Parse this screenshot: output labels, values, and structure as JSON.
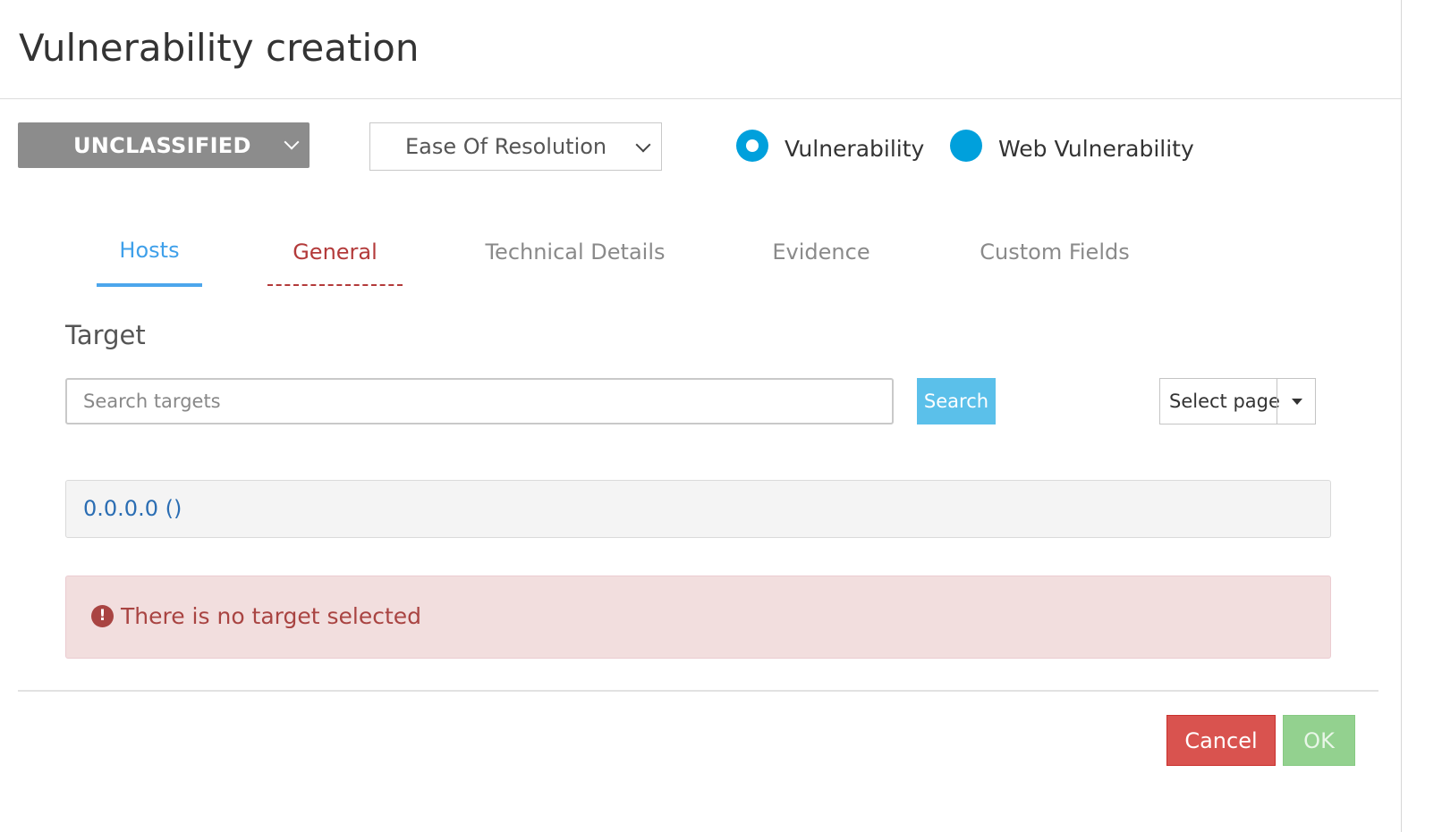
{
  "dialog": {
    "title": "Vulnerability creation"
  },
  "toolbar": {
    "severity_label": "UNCLASSIFIED",
    "ease_label": "Ease Of Resolution",
    "radio_options": [
      {
        "label": "Vulnerability",
        "checked": true
      },
      {
        "label": "Web Vulnerability",
        "checked": false
      }
    ]
  },
  "tabs": [
    {
      "label": "Hosts",
      "state": "active"
    },
    {
      "label": "General",
      "state": "error"
    },
    {
      "label": "Technical Details",
      "state": "normal"
    },
    {
      "label": "Evidence",
      "state": "normal"
    },
    {
      "label": "Custom Fields",
      "state": "normal"
    }
  ],
  "target": {
    "section_title": "Target",
    "search_placeholder": "Search targets",
    "search_value": "",
    "search_button": "Search",
    "page_select_label": "Select page",
    "hosts": [
      "0.0.0.0 ()"
    ],
    "alert_icon": "exclamation-circle-icon",
    "alert_text": "There is no target selected"
  },
  "footer": {
    "cancel_label": "Cancel",
    "ok_label": "OK"
  },
  "colors": {
    "accent": "#00a0dc",
    "tab_active": "#3fa0ea",
    "tab_error": "#b33a3a",
    "severity_bg": "#8c8c8c",
    "danger": "#d9534f",
    "ok_disabled": "#93d18f",
    "alert_bg": "#f2dede",
    "search_button": "#5bc0ea"
  }
}
